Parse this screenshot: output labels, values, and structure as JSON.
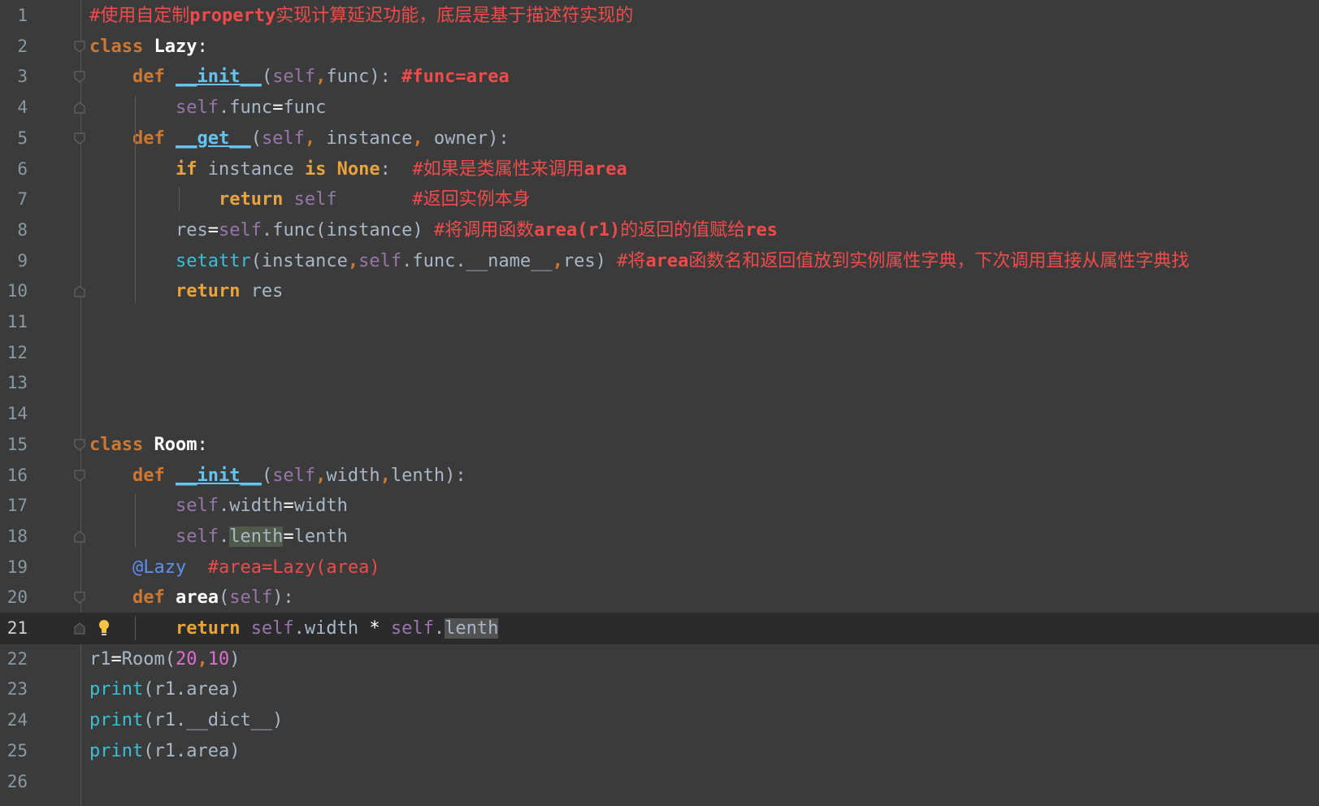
{
  "editor": {
    "current_line": 21,
    "lines": [
      {
        "n": "1",
        "tokens": [
          [
            "cm",
            "#使用自定制"
          ],
          [
            "cmb",
            "property"
          ],
          [
            "cm",
            "实现计算延迟功能，底层是基于描述符实现的"
          ]
        ],
        "fold": null
      },
      {
        "n": "2",
        "tokens": [
          [
            "kw",
            "class "
          ],
          [
            "cls",
            "Lazy"
          ],
          [
            "punc",
            ":"
          ]
        ],
        "fold": "open"
      },
      {
        "n": "3",
        "tokens": [
          [
            "sp",
            "    "
          ],
          [
            "kw",
            "def "
          ],
          [
            "magic",
            "__init__"
          ],
          [
            "txt",
            "("
          ],
          [
            "self",
            "self"
          ],
          [
            "kw",
            ","
          ],
          [
            "txt",
            "func): "
          ],
          [
            "cmb",
            "#func=area"
          ]
        ],
        "fold": "open"
      },
      {
        "n": "4",
        "tokens": [
          [
            "sp",
            "        "
          ],
          [
            "self",
            "self"
          ],
          [
            "txt",
            ".func"
          ],
          [
            "punc",
            "="
          ],
          [
            "txt",
            "func"
          ]
        ],
        "fold": "close"
      },
      {
        "n": "5",
        "tokens": [
          [
            "sp",
            "    "
          ],
          [
            "kw",
            "def "
          ],
          [
            "magic",
            "__get__"
          ],
          [
            "txt",
            "("
          ],
          [
            "self",
            "self"
          ],
          [
            "kw",
            ", "
          ],
          [
            "txt",
            "instance"
          ],
          [
            "kw",
            ", "
          ],
          [
            "txt",
            "owner):"
          ]
        ],
        "fold": "open"
      },
      {
        "n": "6",
        "tokens": [
          [
            "sp",
            "        "
          ],
          [
            "kwp",
            "if "
          ],
          [
            "txt",
            "instance "
          ],
          [
            "kwp",
            "is None"
          ],
          [
            "txt",
            ":  "
          ],
          [
            "cm",
            "#如果是类属性来调用"
          ],
          [
            "cmb",
            "area"
          ]
        ],
        "fold": null
      },
      {
        "n": "7",
        "tokens": [
          [
            "sp",
            "            "
          ],
          [
            "kwp",
            "return "
          ],
          [
            "self",
            "self"
          ],
          [
            "txt",
            "       "
          ],
          [
            "cm",
            "#返回实例本身"
          ]
        ],
        "fold": null
      },
      {
        "n": "8",
        "tokens": [
          [
            "sp",
            "        "
          ],
          [
            "txt",
            "res"
          ],
          [
            "punc",
            "="
          ],
          [
            "self",
            "self"
          ],
          [
            "txt",
            ".func(instance) "
          ],
          [
            "cm",
            "#将调用函数"
          ],
          [
            "cmb",
            "area(r1)"
          ],
          [
            "cm",
            "的返回的值赋给"
          ],
          [
            "cmb",
            "res"
          ]
        ],
        "fold": null
      },
      {
        "n": "9",
        "tokens": [
          [
            "sp",
            "        "
          ],
          [
            "builtin",
            "setattr"
          ],
          [
            "txt",
            "(instance"
          ],
          [
            "kw",
            ","
          ],
          [
            "self",
            "self"
          ],
          [
            "txt",
            ".func.__name__"
          ],
          [
            "kw",
            ","
          ],
          [
            "txt",
            "res) "
          ],
          [
            "cm",
            "#将"
          ],
          [
            "cmb",
            "area"
          ],
          [
            "cm",
            "函数名和返回值放到实例属性字典，下次调用直接从属性字典找"
          ]
        ],
        "fold": null
      },
      {
        "n": "10",
        "tokens": [
          [
            "sp",
            "        "
          ],
          [
            "kwp",
            "return "
          ],
          [
            "txt",
            "res"
          ]
        ],
        "fold": "close"
      },
      {
        "n": "11",
        "tokens": [],
        "fold": null
      },
      {
        "n": "12",
        "tokens": [],
        "fold": null
      },
      {
        "n": "13",
        "tokens": [],
        "fold": null
      },
      {
        "n": "14",
        "tokens": [],
        "fold": null
      },
      {
        "n": "15",
        "tokens": [
          [
            "kw",
            "class "
          ],
          [
            "cls",
            "Room"
          ],
          [
            "punc",
            ":"
          ]
        ],
        "fold": "open"
      },
      {
        "n": "16",
        "tokens": [
          [
            "sp",
            "    "
          ],
          [
            "kw",
            "def "
          ],
          [
            "magic",
            "__init__"
          ],
          [
            "txt",
            "("
          ],
          [
            "self",
            "self"
          ],
          [
            "kw",
            ","
          ],
          [
            "txt",
            "width"
          ],
          [
            "kw",
            ","
          ],
          [
            "txt",
            "lenth):"
          ]
        ],
        "fold": "open"
      },
      {
        "n": "17",
        "tokens": [
          [
            "sp",
            "        "
          ],
          [
            "self",
            "self"
          ],
          [
            "txt",
            ".width"
          ],
          [
            "punc",
            "="
          ],
          [
            "txt",
            "width"
          ]
        ],
        "fold": null
      },
      {
        "n": "18",
        "tokens": [
          [
            "sp",
            "        "
          ],
          [
            "self",
            "self"
          ],
          [
            "txt",
            "."
          ],
          [
            "hl1",
            "lenth"
          ],
          [
            "punc",
            "="
          ],
          [
            "txt",
            "lenth"
          ]
        ],
        "fold": "close"
      },
      {
        "n": "19",
        "tokens": [
          [
            "sp",
            "    "
          ],
          [
            "deco",
            "@Lazy"
          ],
          [
            "txt",
            "  "
          ],
          [
            "cm",
            "#area=Lazy(area)"
          ]
        ],
        "fold": null
      },
      {
        "n": "20",
        "tokens": [
          [
            "sp",
            "    "
          ],
          [
            "kw",
            "def "
          ],
          [
            "cls",
            "area"
          ],
          [
            "txt",
            "("
          ],
          [
            "self",
            "self"
          ],
          [
            "txt",
            "):"
          ]
        ],
        "fold": "open"
      },
      {
        "n": "21",
        "tokens": [
          [
            "sp",
            "        "
          ],
          [
            "kwp",
            "return "
          ],
          [
            "self",
            "self"
          ],
          [
            "txt",
            ".width "
          ],
          [
            "punc",
            "* "
          ],
          [
            "self",
            "self"
          ],
          [
            "txt",
            "."
          ],
          [
            "hl2",
            "lenth"
          ]
        ],
        "fold": "close"
      },
      {
        "n": "22",
        "tokens": [
          [
            "txt",
            "r1"
          ],
          [
            "punc",
            "="
          ],
          [
            "txt",
            "Room("
          ],
          [
            "num",
            "20"
          ],
          [
            "kw",
            ","
          ],
          [
            "num",
            "10"
          ],
          [
            "txt",
            ")"
          ]
        ],
        "fold": null
      },
      {
        "n": "23",
        "tokens": [
          [
            "builtin",
            "print"
          ],
          [
            "txt",
            "(r1.area)"
          ]
        ],
        "fold": null
      },
      {
        "n": "24",
        "tokens": [
          [
            "builtin",
            "print"
          ],
          [
            "txt",
            "(r1.__dict__)"
          ]
        ],
        "fold": null
      },
      {
        "n": "25",
        "tokens": [
          [
            "builtin",
            "print"
          ],
          [
            "txt",
            "(r1.area)"
          ]
        ],
        "fold": null
      },
      {
        "n": "26",
        "tokens": [],
        "fold": null
      }
    ]
  },
  "icons": {
    "intention": "lightbulb-icon"
  }
}
